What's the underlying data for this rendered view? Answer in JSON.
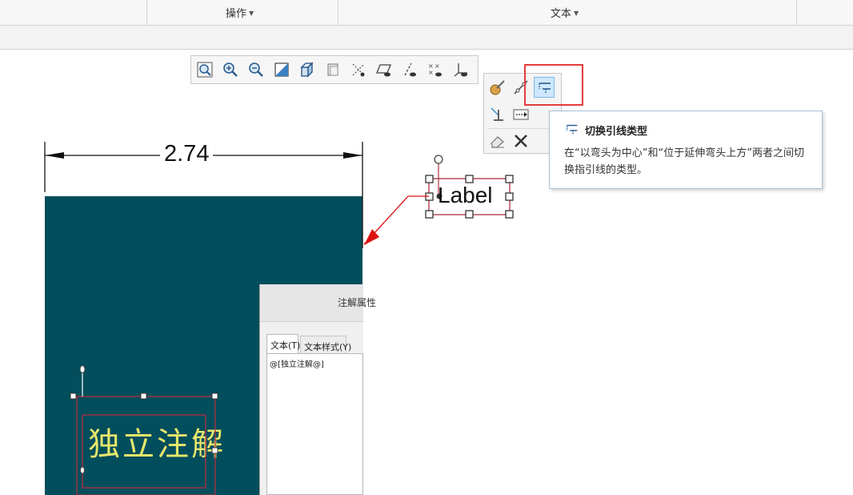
{
  "ribbon": {
    "groups": [
      {
        "label": "操作"
      },
      {
        "label": "文本"
      }
    ]
  },
  "view_toolbar": {
    "buttons": [
      {
        "icon": "refit-zoom-icon"
      },
      {
        "icon": "zoom-in-icon"
      },
      {
        "icon": "zoom-out-icon"
      },
      {
        "icon": "repaint-icon"
      },
      {
        "icon": "display-style-icon"
      },
      {
        "icon": "saved-orientations-icon"
      },
      {
        "icon": "datum-display-icon"
      },
      {
        "icon": "plane-display-icon"
      },
      {
        "icon": "axis-display-icon"
      },
      {
        "icon": "point-display-icon"
      },
      {
        "icon": "csys-display-icon"
      }
    ]
  },
  "mini_toolbar": {
    "buttons": [
      {
        "icon": "text-style-icon"
      },
      {
        "icon": "leader-attach-icon"
      },
      {
        "icon": "toggle-leader-type-icon",
        "active": true
      },
      {
        "icon": "align-note-icon"
      },
      {
        "icon": "text-leader-arrow-icon"
      },
      {
        "icon": "eraser-icon"
      },
      {
        "icon": "delete-x-icon"
      }
    ]
  },
  "tooltip": {
    "title": "切换引线类型",
    "description": "在“以弯头为中心”和“位于延伸弯头上方”两者之间切换指引线的类型。"
  },
  "drawing": {
    "dimension_value": "2.74",
    "label_note": "Label",
    "independent_note": "独立注解"
  },
  "dialog": {
    "title": "注解属性",
    "tabs": [
      {
        "label": "文本(T)"
      },
      {
        "label": "文本样式(Y)"
      }
    ],
    "text_content": "@[独立注解@]"
  },
  "colors": {
    "model_background": "#034e5c",
    "note_text": "#e7e76b",
    "selection": "#b03040",
    "highlight": "#e43b3b",
    "leader_arrow": "#dd1111"
  }
}
